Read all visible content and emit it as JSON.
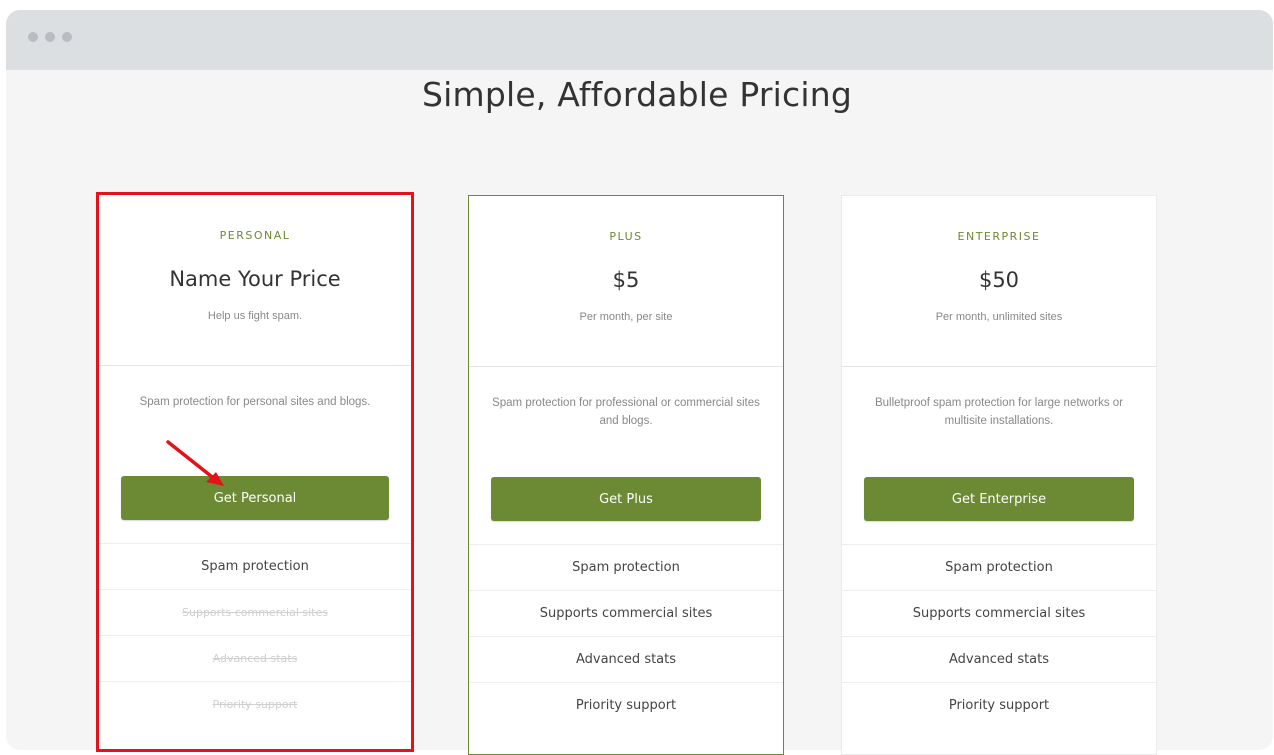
{
  "page": {
    "title": "Simple, Affordable Pricing"
  },
  "plans": [
    {
      "tier": "PERSONAL",
      "price": "Name Your Price",
      "price_sub": "Help us fight spam.",
      "description": "Spam protection for personal sites and blogs.",
      "button": "Get Personal",
      "highlighted": true,
      "features": [
        {
          "label": "Spam protection",
          "included": true
        },
        {
          "label": "Supports commercial sites",
          "included": false
        },
        {
          "label": "Advanced stats",
          "included": false
        },
        {
          "label": "Priority support",
          "included": false
        }
      ]
    },
    {
      "tier": "PLUS",
      "price": "$5",
      "price_sub": "Per month, per site",
      "description": "Spam protection for professional or commercial sites and blogs.",
      "button": "Get Plus",
      "features": [
        {
          "label": "Spam protection",
          "included": true
        },
        {
          "label": "Supports commercial sites",
          "included": true
        },
        {
          "label": "Advanced stats",
          "included": true
        },
        {
          "label": "Priority support",
          "included": true
        }
      ]
    },
    {
      "tier": "ENTERPRISE",
      "price": "$50",
      "price_sub": "Per month, unlimited sites",
      "description": "Bulletproof spam protection for large networks or multisite installations.",
      "button": "Get Enterprise",
      "features": [
        {
          "label": "Spam protection",
          "included": true
        },
        {
          "label": "Supports commercial sites",
          "included": true
        },
        {
          "label": "Advanced stats",
          "included": true
        },
        {
          "label": "Priority support",
          "included": true
        }
      ]
    }
  ],
  "colors": {
    "accent": "#6b8a33",
    "highlight_border": "#e3121b",
    "annotation_arrow": "#e3121b"
  }
}
